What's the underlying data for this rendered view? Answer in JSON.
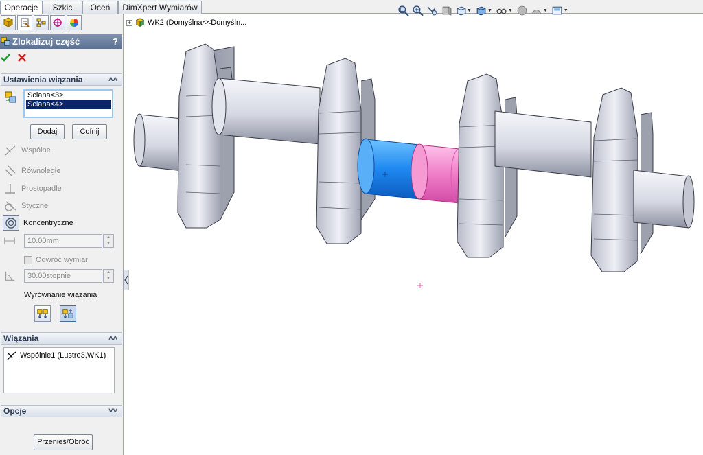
{
  "tabs": [
    "Operacje",
    "Szkic",
    "Oceń",
    "DimXpert Wymiarów"
  ],
  "tree": {
    "expand": "+",
    "label": "WK2  (Domyślna<<Domyśln..."
  },
  "pm": {
    "title": "Zlokalizuj część",
    "help": "?",
    "mate_selections_header": "Ustawienia wiązania",
    "selections": [
      "Ściana<3>",
      "Ściana<4>"
    ],
    "add_button": "Dodaj",
    "undo_button": "Cofnij",
    "mate_types": {
      "coincident": "Wspólne",
      "parallel": "Równoległe",
      "perpendicular": "Prostopadłe",
      "tangent": "Styczne",
      "concentric": "Koncentryczne"
    },
    "distance_value": "10.00mm",
    "flip_dimension": "Odwróć wymiar",
    "angle_value": "30.00stopnie",
    "mate_alignment": "Wyrównanie wiązania",
    "mates_header": "Wiązania",
    "mates": [
      "Wspólnie1 (Lustro3,WK1)"
    ],
    "options_header": "Opcje",
    "move_rotate_button": "Przenieś/Obróć"
  },
  "colors": {
    "accent_blue": "#1e88f0",
    "accent_pink": "#f07ec8",
    "title_bar": "#5b7091"
  }
}
